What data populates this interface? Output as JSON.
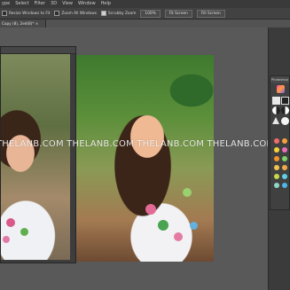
{
  "menubar": {
    "items": [
      "ype",
      "Select",
      "Filter",
      "3D",
      "View",
      "Window",
      "Help"
    ]
  },
  "options": {
    "resize_windows": "Resize Windows to Fit",
    "zoom_all": "Zoom All Windows",
    "scrubby_zoom": "Scrubby Zoom",
    "zoom_level": "100%",
    "fit_screen": "Fit Screen",
    "fill_screen": "Fill Screen"
  },
  "document": {
    "tab": "Copy (8), 2ed(8)* ×"
  },
  "watermark": {
    "text": "THELANB.COM THELANB.COM THELANB.COM THELANB.COM"
  },
  "panel": {
    "title": "Photoshop",
    "swatches": [
      "#f36b6b",
      "#f6a03c",
      "#f6d33c",
      "#e86fb6",
      "#f0932b",
      "#7fd26b",
      "#f4c24e",
      "#f1a94a",
      "#c7d84a",
      "#62d0e8",
      "#8fd6c7",
      "#4fb7e8"
    ]
  }
}
